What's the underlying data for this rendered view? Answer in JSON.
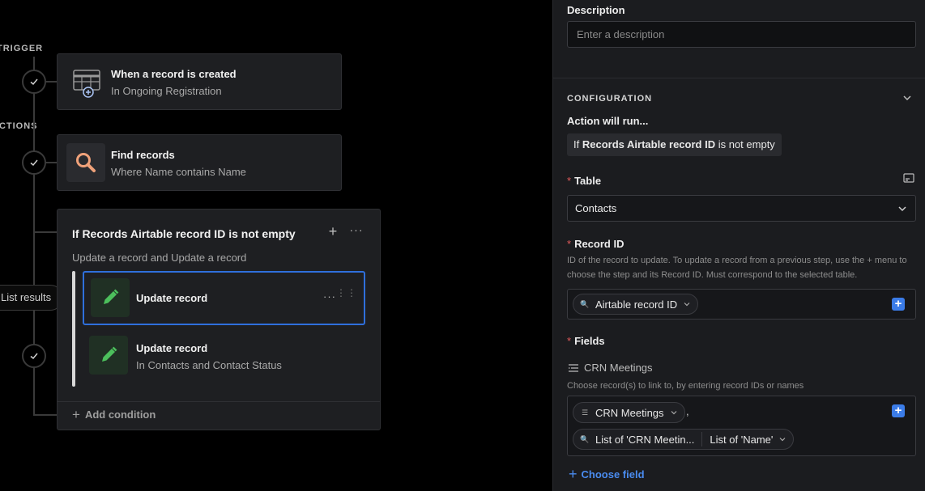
{
  "canvas": {
    "trigger_label": "TRIGGER",
    "actions_label": "ACTIONS",
    "trigger_card": {
      "title": "When a record is created",
      "subtitle": "In Ongoing Registration"
    },
    "find_card": {
      "title": "Find records",
      "subtitle": "Where Name contains Name"
    },
    "condition_group": {
      "title": "If Records Airtable record ID is not empty",
      "subtitle": "Update a record and Update a record",
      "steps": [
        {
          "title": "Update record",
          "subtitle": ""
        },
        {
          "title": "Update record",
          "subtitle": "In Contacts and Contact Status"
        }
      ],
      "add_condition_label": "Add condition"
    },
    "results_pill": "List results"
  },
  "panel": {
    "description": {
      "label": "Description",
      "placeholder": "Enter a description"
    },
    "configuration_label": "CONFIGURATION",
    "action_will_run_label": "Action will run...",
    "summary": {
      "prefix": "If",
      "subject": "Records Airtable record ID",
      "suffix": "is not empty"
    },
    "table": {
      "label": "Table",
      "value": "Contacts"
    },
    "record_id": {
      "label": "Record ID",
      "help": "ID of the record to update. To update a record from a previous step, use the + menu to choose the step and its Record ID. Must correspond to the selected table.",
      "token": "Airtable record ID"
    },
    "fields": {
      "label": "Fields",
      "field_name": "CRN Meetings",
      "help": "Choose record(s) to link to, by entering record IDs or names",
      "tokens": {
        "first": "CRN Meetings",
        "second_a": "List of 'CRN Meetin...",
        "second_b": "List of 'Name'"
      },
      "comma": ","
    },
    "choose_field_label": "Choose field"
  },
  "colors": {
    "accent_blue": "#2f6fdc",
    "link_blue": "#4a8cf0",
    "pencil_green": "#4cbf5c",
    "search_orange": "#f0a27a"
  }
}
